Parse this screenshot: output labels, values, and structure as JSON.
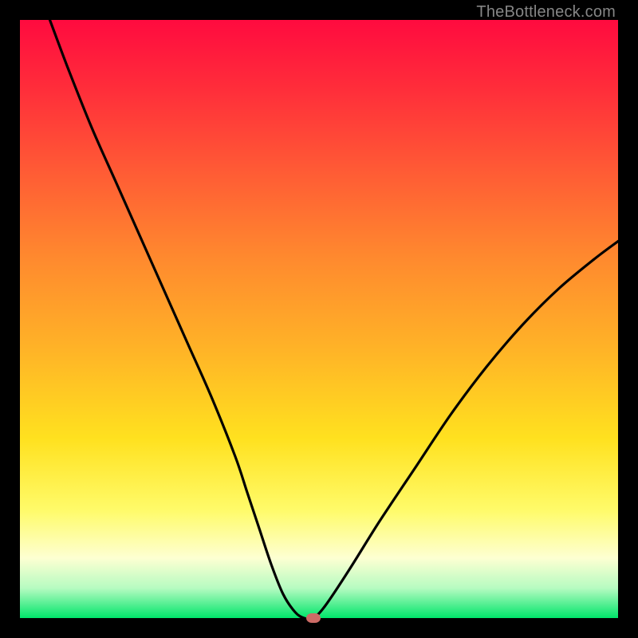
{
  "watermark": "TheBottleneck.com",
  "colors": {
    "frame": "#000000",
    "curve": "#000000",
    "marker": "#cc6b66",
    "gradient_top": "#ff0b3f",
    "gradient_bottom": "#00e56a"
  },
  "chart_data": {
    "type": "line",
    "title": "",
    "xlabel": "",
    "ylabel": "",
    "xlim": [
      0,
      100
    ],
    "ylim": [
      0,
      100
    ],
    "grid": false,
    "legend": false,
    "series": [
      {
        "name": "bottleneck-curve",
        "x": [
          5,
          8,
          12,
          16,
          20,
          24,
          28,
          32,
          36,
          38,
          40,
          42,
          44,
          46,
          47.5,
          49,
          51,
          55,
          60,
          66,
          72,
          78,
          84,
          90,
          96,
          100
        ],
        "y": [
          100,
          92,
          82,
          73,
          64,
          55,
          46,
          37,
          27,
          21,
          15,
          9,
          4,
          1,
          0,
          0,
          2,
          8,
          16,
          25,
          34,
          42,
          49,
          55,
          60,
          63
        ]
      }
    ],
    "annotations": [
      {
        "name": "minimum-marker",
        "x": 49,
        "y": 0
      }
    ],
    "background": "vertical-gradient-red-to-green"
  }
}
